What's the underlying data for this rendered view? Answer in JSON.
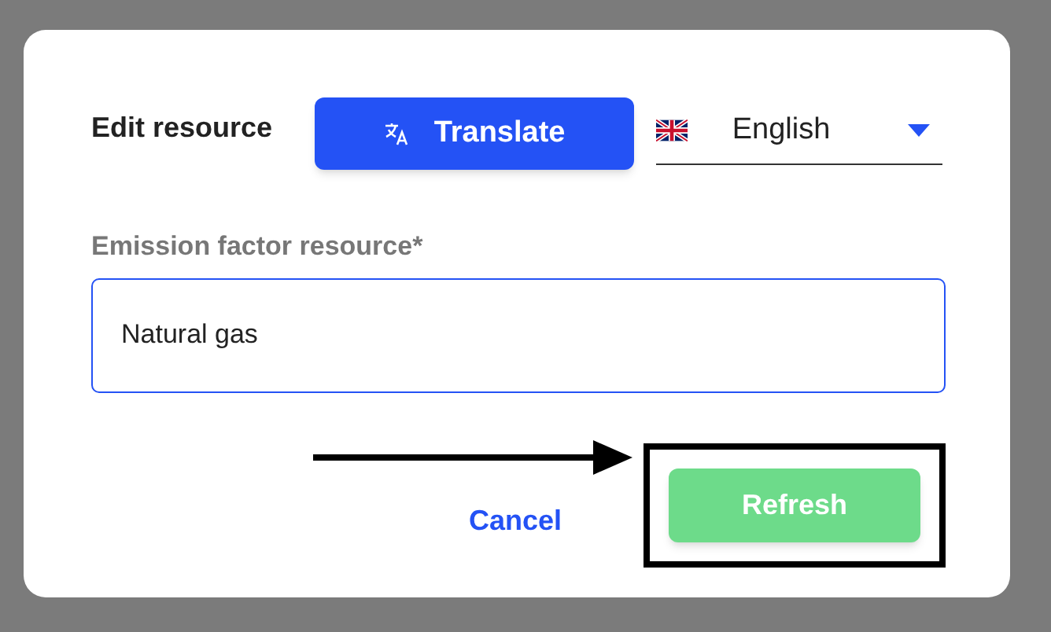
{
  "dialog": {
    "title": "Edit resource",
    "translate_button": {
      "label": "Translate"
    },
    "language_select": {
      "value": "English"
    },
    "field": {
      "label": "Emission factor resource*",
      "value": "Natural gas",
      "focused": true
    },
    "buttons": [
      {
        "label": "Cancel",
        "kind": "text"
      },
      {
        "label": "Refresh",
        "kind": "filled",
        "highlighted": true
      }
    ]
  }
}
